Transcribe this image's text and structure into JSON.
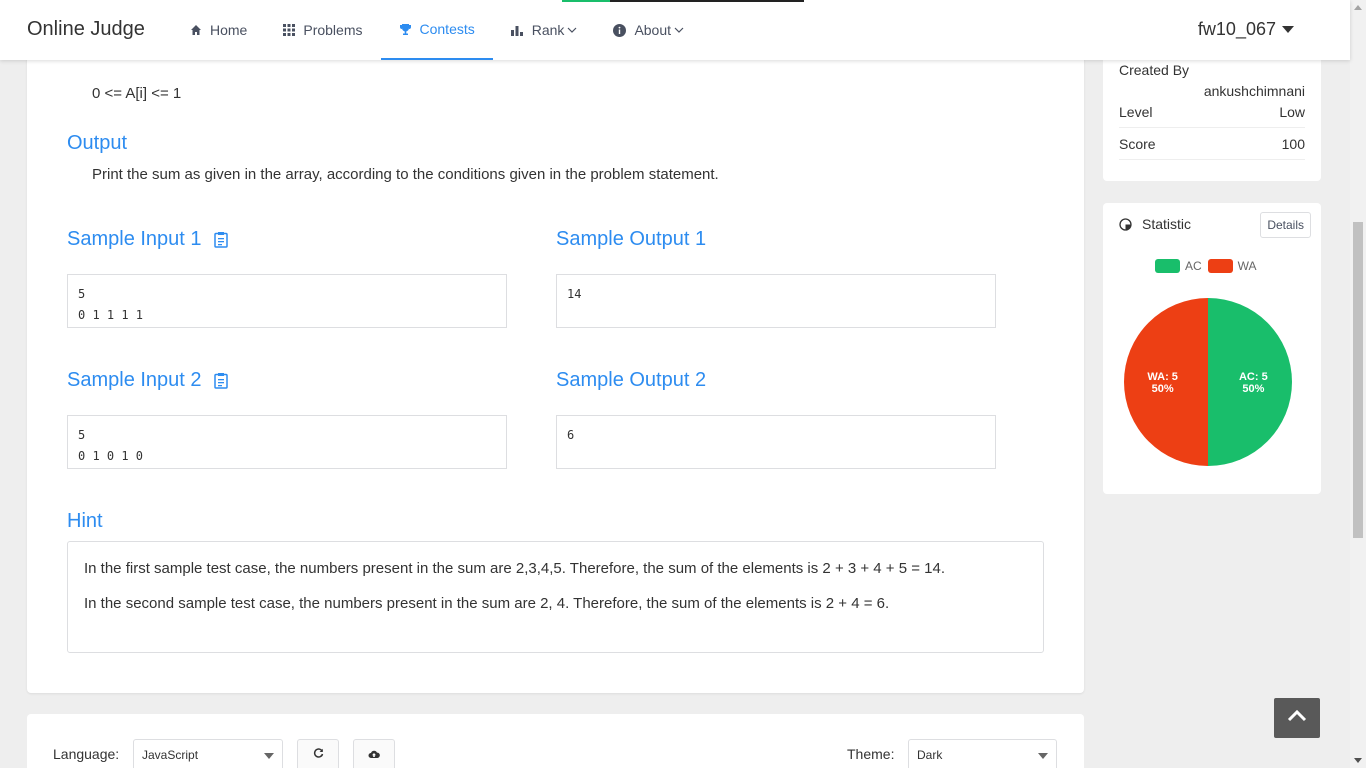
{
  "header": {
    "logo": "Online Judge",
    "nav": [
      {
        "label": "Home",
        "icon": "home-icon"
      },
      {
        "label": "Problems",
        "icon": "grid-icon"
      },
      {
        "label": "Contests",
        "icon": "trophy-icon",
        "active": true
      },
      {
        "label": "Rank",
        "icon": "bar-chart-icon",
        "dropdown": true
      },
      {
        "label": "About",
        "icon": "info-icon",
        "dropdown": true
      }
    ],
    "username": "fw10_067"
  },
  "problem": {
    "constraint": "0 <= A[i] <= 1",
    "output_title": "Output",
    "output_desc": "Print the sum as given in the array, according to the conditions given in the problem statement.",
    "samples": [
      {
        "input_title": "Sample Input 1",
        "input": "5\n0 1 1 1 1",
        "output_title": "Sample Output 1",
        "output": "14"
      },
      {
        "input_title": "Sample Input 2",
        "input": "5\n0 1 0 1 0",
        "output_title": "Sample Output 2",
        "output": "6"
      }
    ],
    "hint_title": "Hint",
    "hint_lines": [
      "In the first sample test case, the numbers present in the sum are 2,3,4,5. Therefore, the sum of the elements is 2 + 3 + 4 + 5 = 14.",
      "In the second sample test case, the numbers present in the sum are 2, 4. Therefore, the sum of the elements is 2 + 4 = 6."
    ]
  },
  "info": {
    "created_by_label": "Created By",
    "created_by_value": "ankushchimnani",
    "level_label": "Level",
    "level_value": "Low",
    "score_label": "Score",
    "score_value": "100"
  },
  "statistic": {
    "title": "Statistic",
    "details_label": "Details",
    "legend": [
      {
        "name": "AC",
        "color": "#19be6b"
      },
      {
        "name": "WA",
        "color": "#ed3f14"
      }
    ],
    "chart_data": {
      "type": "pie",
      "slices": [
        {
          "name": "AC",
          "value": 5,
          "percent": "50%",
          "color": "#19be6b",
          "label": "AC: 5"
        },
        {
          "name": "WA",
          "value": 5,
          "percent": "50%",
          "color": "#ed3f14",
          "label": "WA: 5"
        }
      ]
    }
  },
  "editor": {
    "language_label": "Language:",
    "language_value": "JavaScript",
    "theme_label": "Theme:",
    "theme_value": "Dark"
  }
}
